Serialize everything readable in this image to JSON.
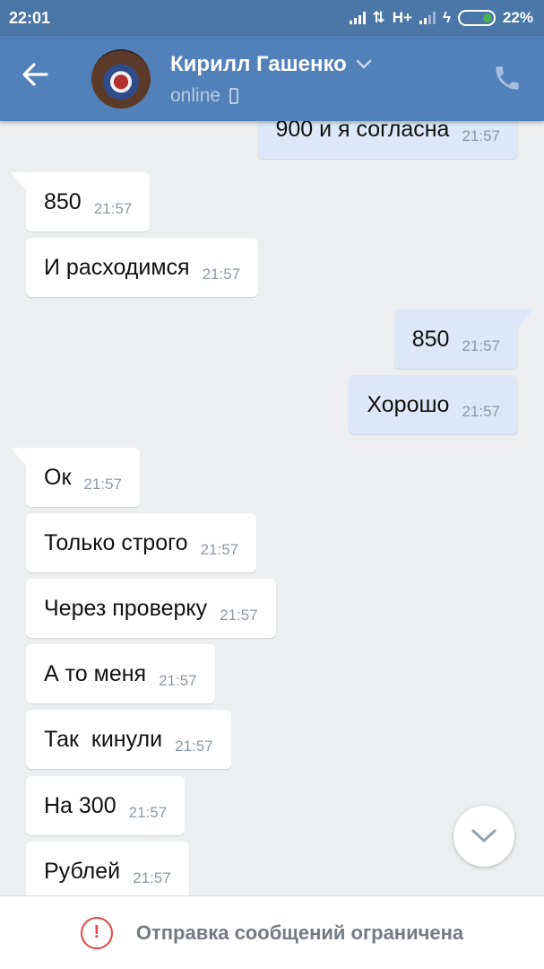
{
  "status_bar": {
    "time": "22:01",
    "network": "H+",
    "battery": "22%"
  },
  "header": {
    "contact_name": "Кирилл Гашенко",
    "presence": "online",
    "icons": [
      "back-arrow-icon",
      "chevron-down-icon",
      "mobile-device-icon",
      "phone-call-icon"
    ]
  },
  "messages": [
    {
      "dir": "out",
      "text": "900 и я согласна",
      "time": "21:57"
    },
    {
      "dir": "in",
      "text": "850",
      "time": "21:57"
    },
    {
      "dir": "in",
      "text": "И расходимся",
      "time": "21:57"
    },
    {
      "dir": "out",
      "text": "850",
      "time": "21:57"
    },
    {
      "dir": "out",
      "text": "Хорошо",
      "time": "21:57"
    },
    {
      "dir": "in",
      "text": "Ок",
      "time": "21:57"
    },
    {
      "dir": "in",
      "text": "Только строго",
      "time": "21:57"
    },
    {
      "dir": "in",
      "text": "Через проверку",
      "time": "21:57"
    },
    {
      "dir": "in",
      "text": "А то меня",
      "time": "21:57"
    },
    {
      "dir": "in",
      "text": "Так  кинули",
      "time": "21:57"
    },
    {
      "dir": "in",
      "text": "На 300",
      "time": "21:57"
    },
    {
      "dir": "in",
      "text": "Рублей",
      "time": "21:57"
    }
  ],
  "footer": {
    "restriction_text": "Отправка сообщений ограничена",
    "icon": "warning-icon"
  },
  "colors": {
    "header": "#5181b8",
    "status_bar": "#4a76a8",
    "incoming_bubble": "#ffffff",
    "outgoing_bubble": "#dce8f7",
    "background": "#edeef0",
    "warning": "#e64646"
  }
}
